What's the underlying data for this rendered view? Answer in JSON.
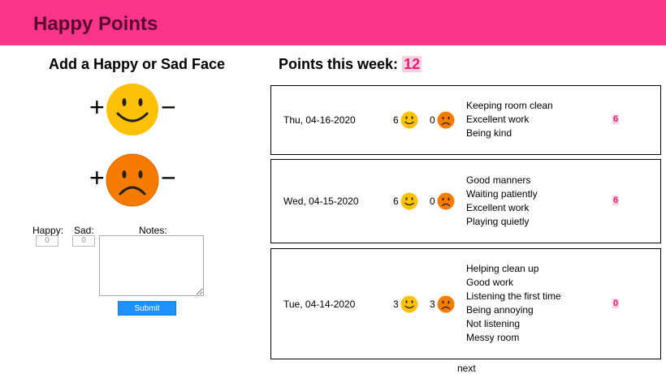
{
  "app": {
    "title": "Happy Points"
  },
  "left": {
    "title": "Add a Happy or Sad Face",
    "plus": "+",
    "minus": "−",
    "happy_label": "Happy:",
    "sad_label": "Sad:",
    "notes_label": "Notes:",
    "happy_value": "0",
    "sad_value": "0",
    "submit_label": "Submit"
  },
  "points": {
    "label": "Points this week:",
    "value": "12"
  },
  "entries": [
    {
      "date": "Thu, 04-16-2020",
      "happy": "6",
      "sad": "0",
      "notes": [
        "Keeping room clean",
        "Excellent work",
        "Being kind"
      ],
      "score": "6"
    },
    {
      "date": "Wed, 04-15-2020",
      "happy": "6",
      "sad": "0",
      "notes": [
        "Good manners",
        "Waiting patiently",
        "Excellent work",
        "Playing quietly"
      ],
      "score": "6"
    },
    {
      "date": "Tue, 04-14-2020",
      "happy": "3",
      "sad": "3",
      "notes": [
        "Helping clean up",
        "Good work",
        "Listening the first time",
        "Being annoying",
        "Not listening",
        "Messy room"
      ],
      "score": "0"
    }
  ],
  "pager": {
    "next": "next"
  },
  "colors": {
    "header": "#f9348a",
    "happy_face": "#ffc107",
    "sad_face": "#f57c00",
    "accent": "#ea1e78",
    "submit": "#1e90ff"
  }
}
